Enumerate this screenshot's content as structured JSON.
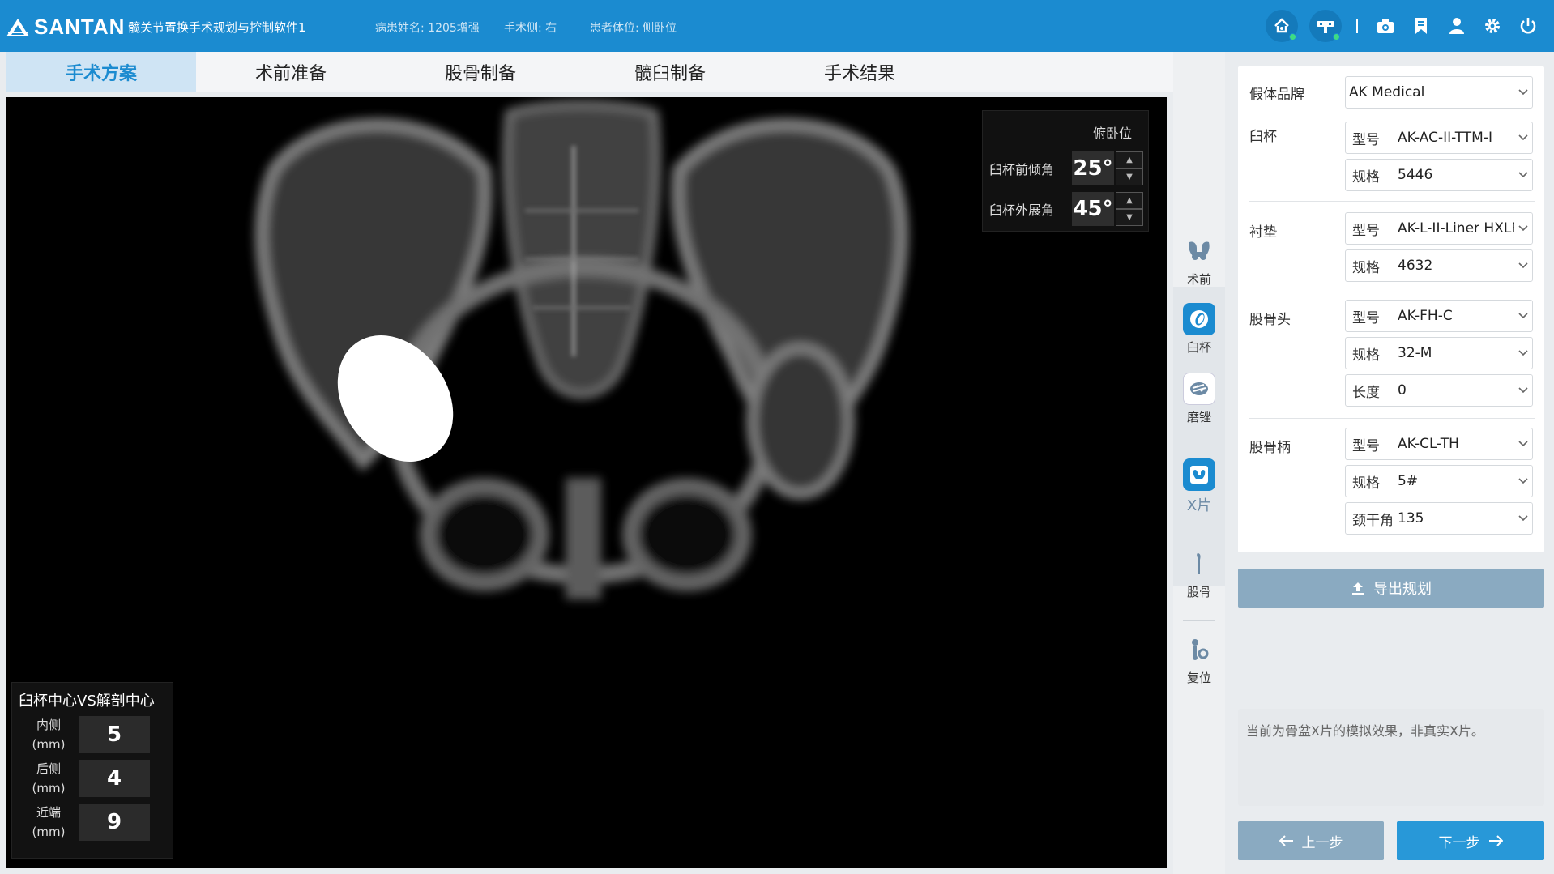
{
  "header": {
    "brand": "SANTAN",
    "app_title": "髋关节置换手术规划与控制软件1",
    "patient_name": "病患姓名: 1205增强",
    "surgery_side": "手术侧: 右",
    "patient_position": "患者体位: 侧卧位",
    "icons": [
      "network-status-icon",
      "device-status-icon",
      "camera-icon",
      "bookmark-icon",
      "user-icon",
      "settings-icon",
      "power-icon"
    ],
    "status_color": "#3ddc84"
  },
  "tabs": [
    {
      "label": "手术方案",
      "active": true
    },
    {
      "label": "术前准备",
      "active": false
    },
    {
      "label": "股骨制备",
      "active": false
    },
    {
      "label": "髋臼制备",
      "active": false
    },
    {
      "label": "手术结果",
      "active": false
    }
  ],
  "viewport": {
    "position_label": "俯卧位",
    "angles": [
      {
        "label": "臼杯前倾角",
        "value": "25°"
      },
      {
        "label": "臼杯外展角",
        "value": "45°"
      }
    ],
    "center_panel": {
      "title": "臼杯中心VS解剖中心",
      "rows": [
        {
          "label": "内侧",
          "unit": "(mm)",
          "value": "5"
        },
        {
          "label": "后侧",
          "unit": "(mm)",
          "value": "4"
        },
        {
          "label": "近端",
          "unit": "(mm)",
          "value": "9"
        }
      ]
    }
  },
  "steps": [
    {
      "label": "术前",
      "icon": "pelvis-icon"
    },
    {
      "label": "臼杯",
      "icon": "cup-icon"
    },
    {
      "label": "磨锉",
      "icon": "reamer-icon"
    },
    {
      "label": "X片",
      "icon": "xray-icon"
    },
    {
      "label": "股骨",
      "icon": "femur-icon"
    },
    {
      "label": "复位",
      "icon": "reduction-icon"
    }
  ],
  "implants": {
    "brand": {
      "label": "假体品牌",
      "value": "AK Medical"
    },
    "cup": {
      "label": "臼杯",
      "model_label": "型号",
      "model": "AK-AC-II-TTM-I",
      "size_label": "规格",
      "size": "5446"
    },
    "liner": {
      "label": "衬垫",
      "model_label": "型号",
      "model": "AK-L-II-Liner HXLPE",
      "size_label": "规格",
      "size": "4632"
    },
    "head": {
      "label": "股骨头",
      "model_label": "型号",
      "model": "AK-FH-C",
      "size_label": "规格",
      "size": "32-M",
      "length_label": "长度",
      "length": "0"
    },
    "stem": {
      "label": "股骨柄",
      "model_label": "型号",
      "model": "AK-CL-TH",
      "size_label": "规格",
      "size": "5#",
      "neck_label": "颈干角",
      "neck": "135"
    }
  },
  "actions": {
    "export": "导出规划",
    "notice": "当前为骨盆X片的模拟效果，非真实X片。",
    "prev": "上一步",
    "next": "下一步"
  }
}
